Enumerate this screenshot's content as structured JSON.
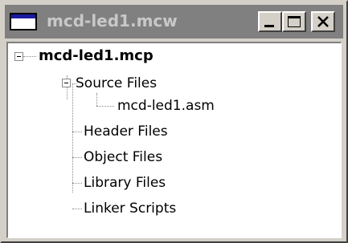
{
  "window": {
    "title": "mcd-led1.mcw",
    "controls": {
      "minimize_icon": "minimize-icon",
      "maximize_icon": "maximize-icon",
      "close_icon": "close-icon"
    }
  },
  "tree": {
    "root": {
      "label": "mcd-led1.mcp",
      "expanded": true
    },
    "source_files": {
      "label": "Source Files",
      "expanded": true,
      "children": [
        {
          "label": "mcd-led1.asm"
        }
      ]
    },
    "folders": [
      {
        "label": "Header Files"
      },
      {
        "label": "Object Files"
      },
      {
        "label": "Library Files"
      },
      {
        "label": "Linker Scripts"
      }
    ]
  },
  "colors": {
    "titlebar_inactive": "#808080",
    "title_text_inactive": "#c8c8c8",
    "window_face": "#d4d0c8",
    "tree_background": "#ffffff"
  }
}
